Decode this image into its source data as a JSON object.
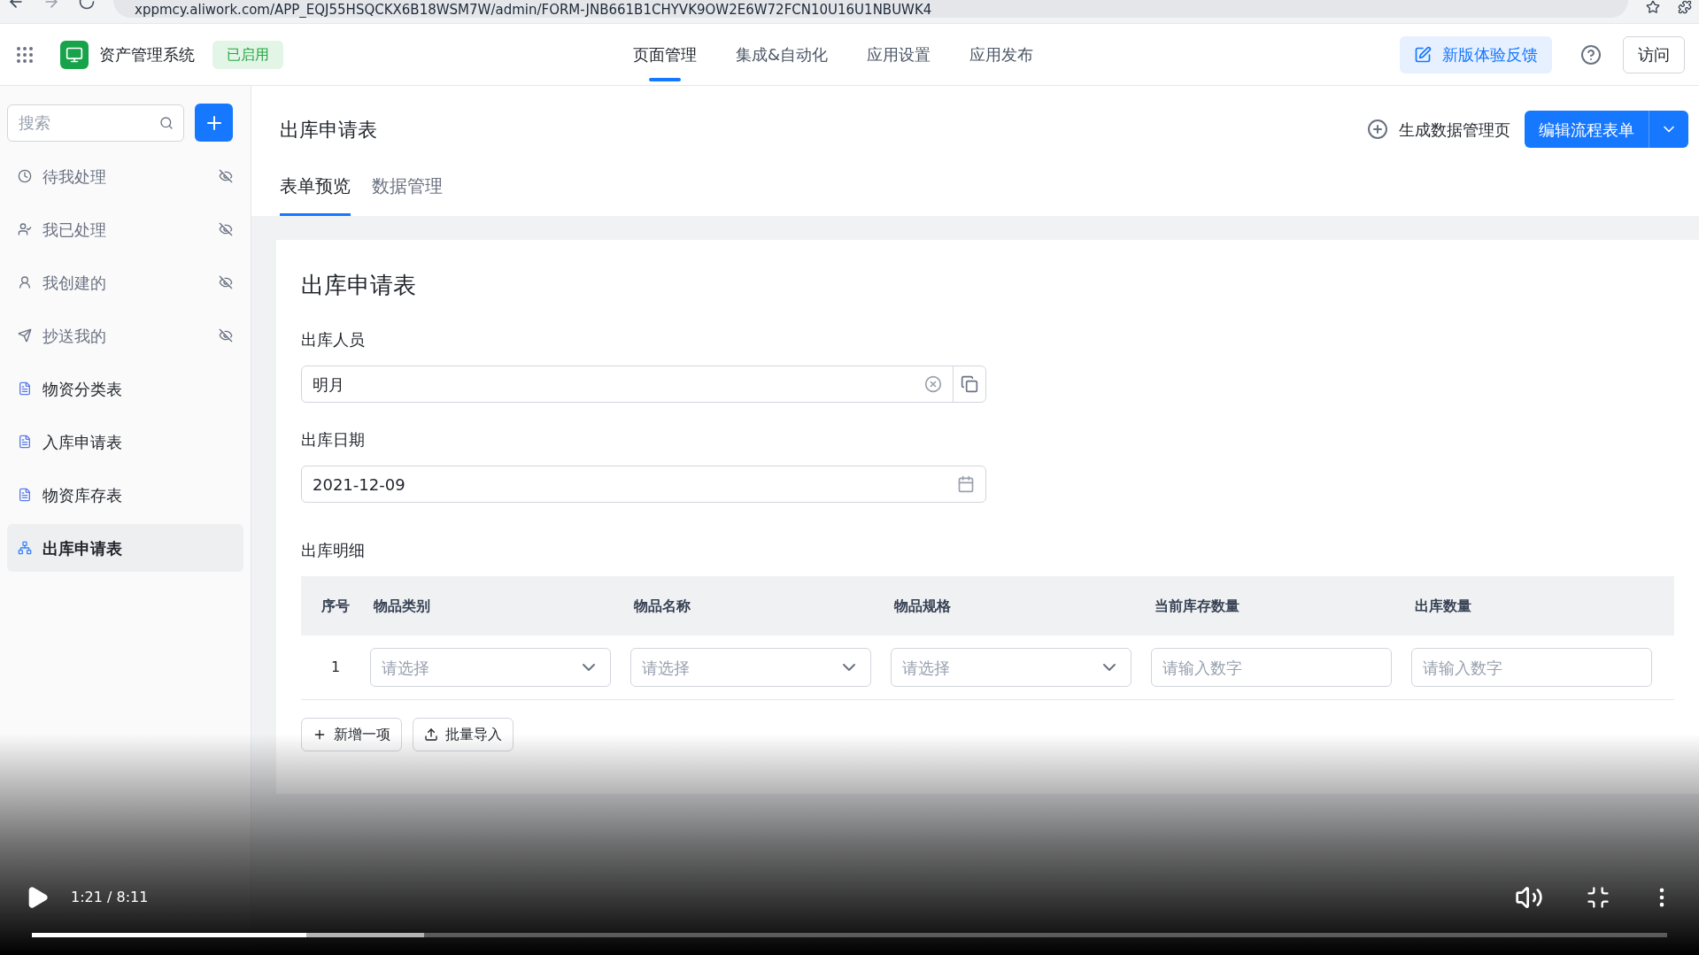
{
  "browser": {
    "url": "xppmcy.aliwork.com/APP_EQJ55HSQCKX6B18WSM7W/admin/FORM-JNB661B1CHYVK9OW2E6W72FCN10U16U1NBUWK4"
  },
  "app": {
    "name": "资产管理系统",
    "status": "已启用"
  },
  "nav": [
    {
      "label": "页面管理",
      "selected": true
    },
    {
      "label": "集成&自动化",
      "selected": false
    },
    {
      "label": "应用设置",
      "selected": false
    },
    {
      "label": "应用发布",
      "selected": false
    }
  ],
  "feedback_button": "新版体验反馈",
  "visit_button": "访问",
  "sidebar": {
    "search_placeholder": "搜索",
    "items": [
      {
        "label": "待我处理",
        "kind": "clock",
        "selected": false
      },
      {
        "label": "我已处理",
        "kind": "user-check",
        "selected": false
      },
      {
        "label": "我创建的",
        "kind": "user-arrow",
        "selected": false
      },
      {
        "label": "抄送我的",
        "kind": "send",
        "selected": false
      },
      {
        "label": "物资分类表",
        "kind": "form",
        "selected": false
      },
      {
        "label": "入库申请表",
        "kind": "form",
        "selected": false
      },
      {
        "label": "物资库存表",
        "kind": "form",
        "selected": false
      },
      {
        "label": "出库申请表",
        "kind": "flow",
        "selected": true
      }
    ]
  },
  "page": {
    "title": "出库申请表",
    "generate_link": "生成数据管理页",
    "edit_button": "编辑流程表单",
    "tabs": [
      {
        "label": "表单预览",
        "selected": true
      },
      {
        "label": "数据管理",
        "selected": false
      }
    ]
  },
  "form": {
    "title": "出库申请表",
    "fields": [
      {
        "label": "出库人员",
        "kind": "person",
        "value": "明月"
      },
      {
        "label": "出库日期",
        "kind": "date",
        "value": "2021-12-09"
      }
    ],
    "table": {
      "label": "出库明细",
      "columns": [
        "序号",
        "物品类别",
        "物品名称",
        "物品规格",
        "当前库存数量",
        "出库数量"
      ],
      "rows": [
        {
          "cells": [
            {
              "kind": "index",
              "text": "1"
            },
            {
              "kind": "select",
              "placeholder": "请选择"
            },
            {
              "kind": "select",
              "placeholder": "请选择"
            },
            {
              "kind": "select",
              "placeholder": "请选择"
            },
            {
              "kind": "number",
              "placeholder": "请输入数字"
            },
            {
              "kind": "number",
              "placeholder": "请输入数字"
            }
          ]
        }
      ]
    },
    "buttons": [
      {
        "label": "新增一项",
        "kind": "add"
      },
      {
        "label": "批量导入",
        "kind": "import"
      }
    ]
  },
  "player": {
    "time": "1:21 / 8:11",
    "level": 0.168
  }
}
